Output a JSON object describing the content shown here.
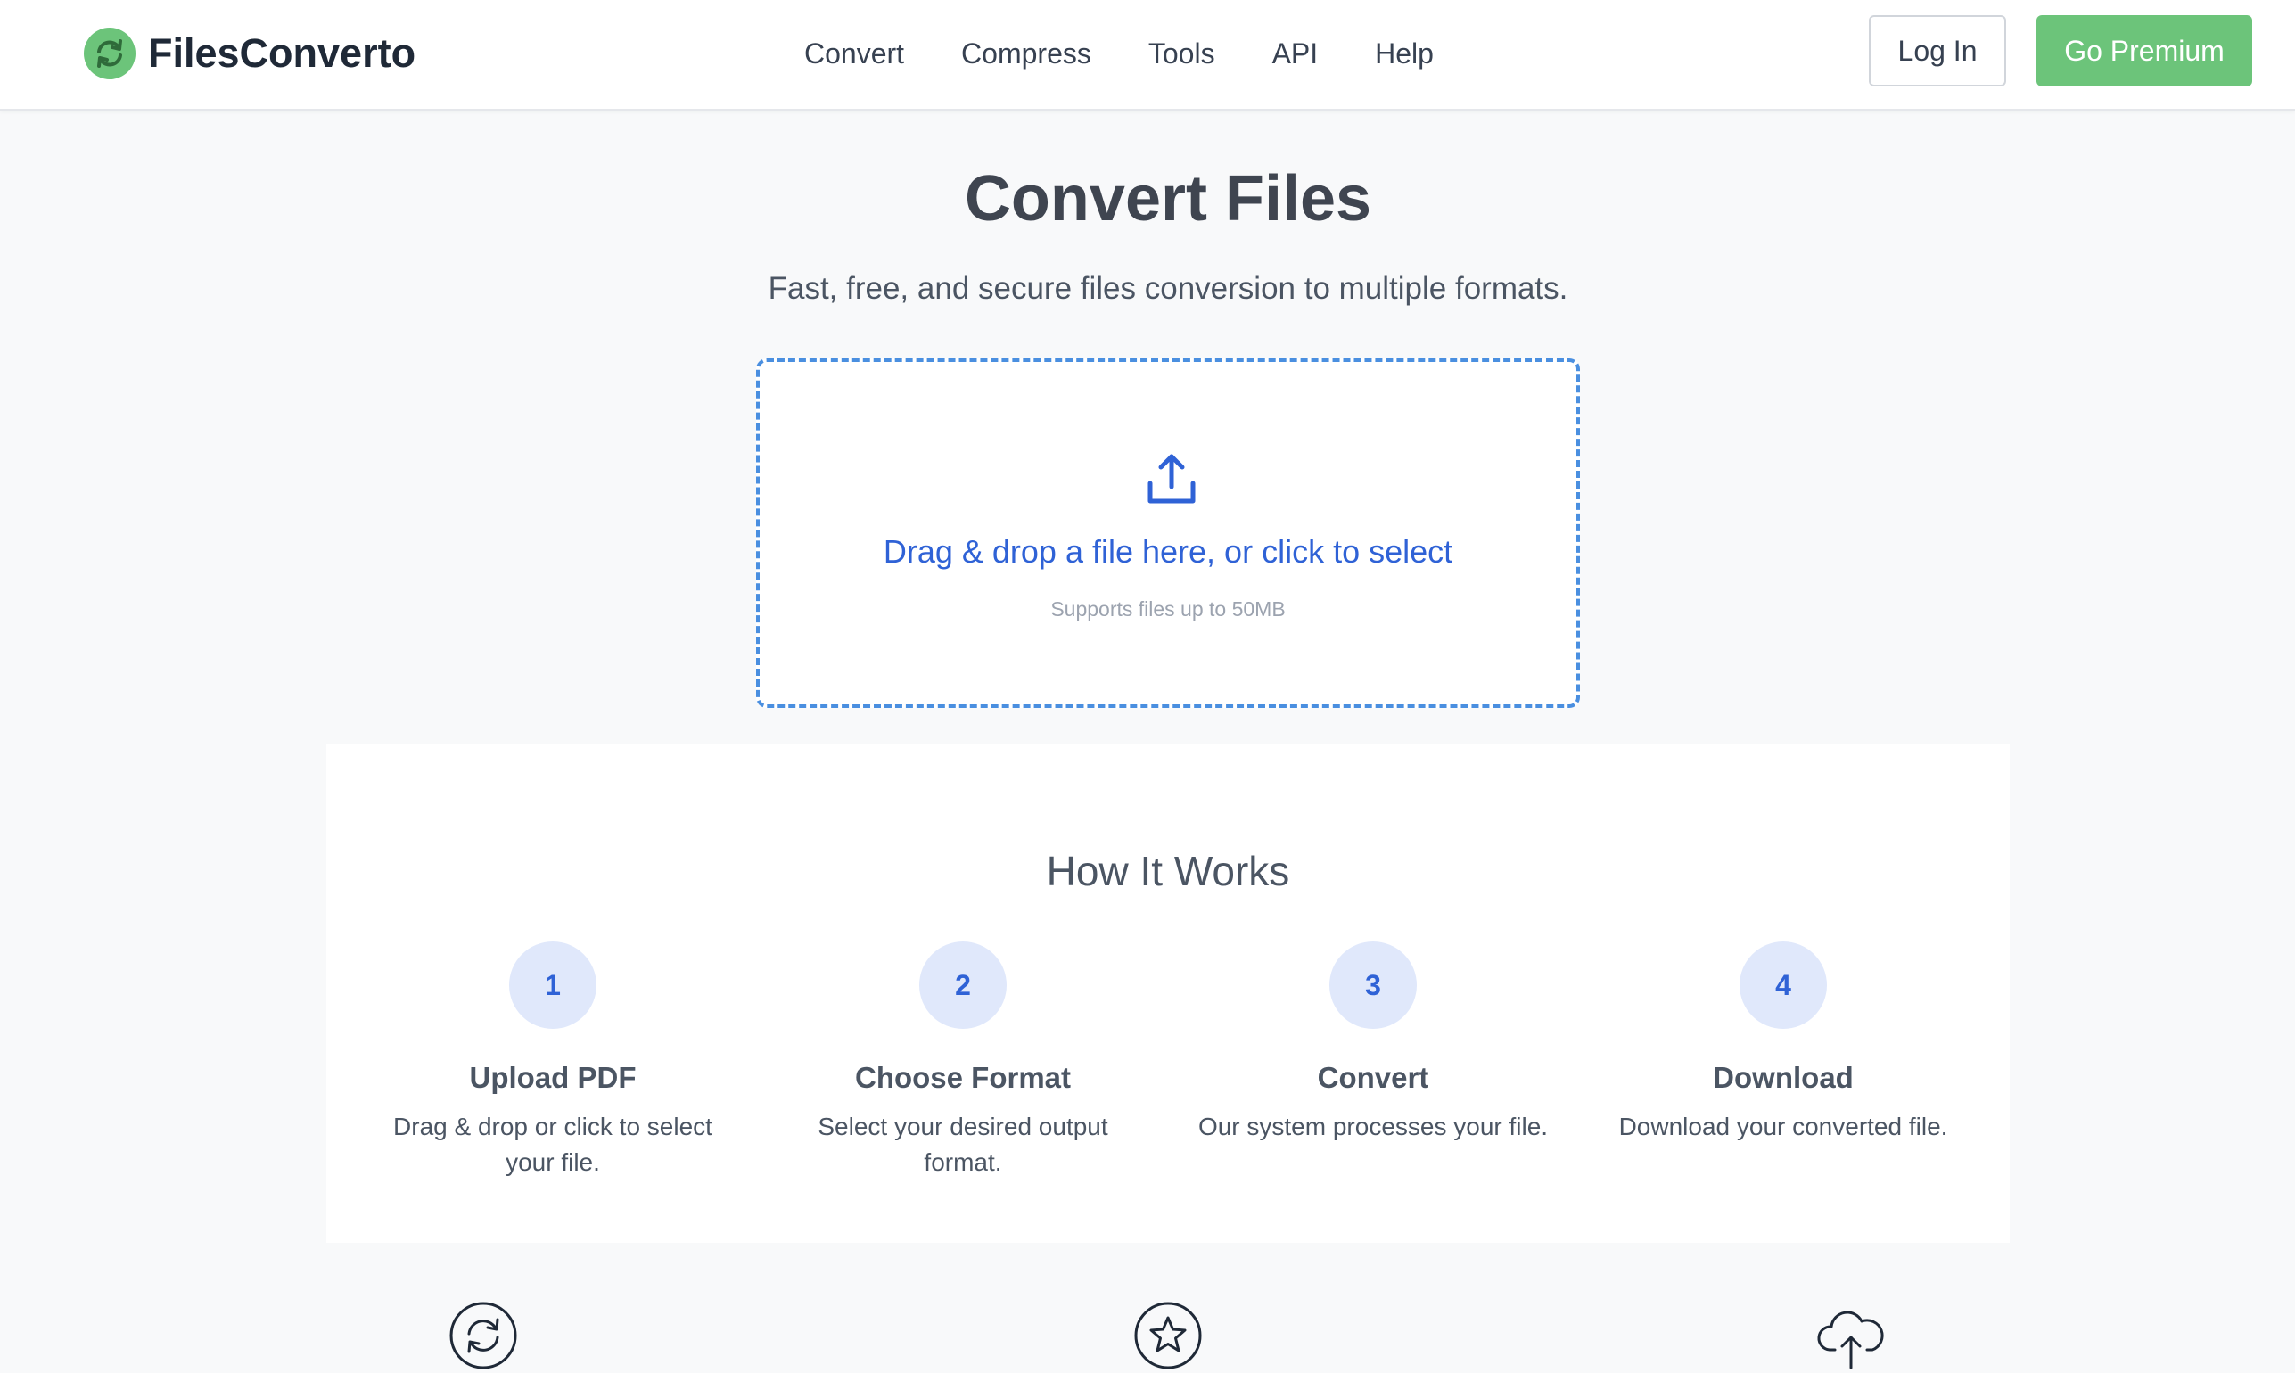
{
  "brand": {
    "name": "FilesConverto",
    "logo_icon": "refresh-circle-icon",
    "accent": "#6cc47a"
  },
  "nav": {
    "items": [
      "Convert",
      "Compress",
      "Tools",
      "API",
      "Help"
    ]
  },
  "header_actions": {
    "login_label": "Log In",
    "premium_label": "Go Premium"
  },
  "hero": {
    "title": "Convert Files",
    "subtitle": "Fast, free, and secure files conversion to multiple formats."
  },
  "dropzone": {
    "icon": "upload-icon",
    "prompt": "Drag & drop a file here, or click to select",
    "note": "Supports files up to 50MB",
    "accent": "#2f62d6"
  },
  "how_it_works": {
    "title": "How It Works",
    "steps": [
      {
        "number": "1",
        "title": "Upload PDF",
        "description": "Drag & drop or click to select your file."
      },
      {
        "number": "2",
        "title": "Choose Format",
        "description": "Select your desired output format."
      },
      {
        "number": "3",
        "title": "Convert",
        "description": "Our system processes your file."
      },
      {
        "number": "4",
        "title": "Download",
        "description": "Download your converted file."
      }
    ]
  },
  "features": {
    "icons": [
      "refresh-icon",
      "star-icon",
      "cloud-upload-icon"
    ]
  }
}
